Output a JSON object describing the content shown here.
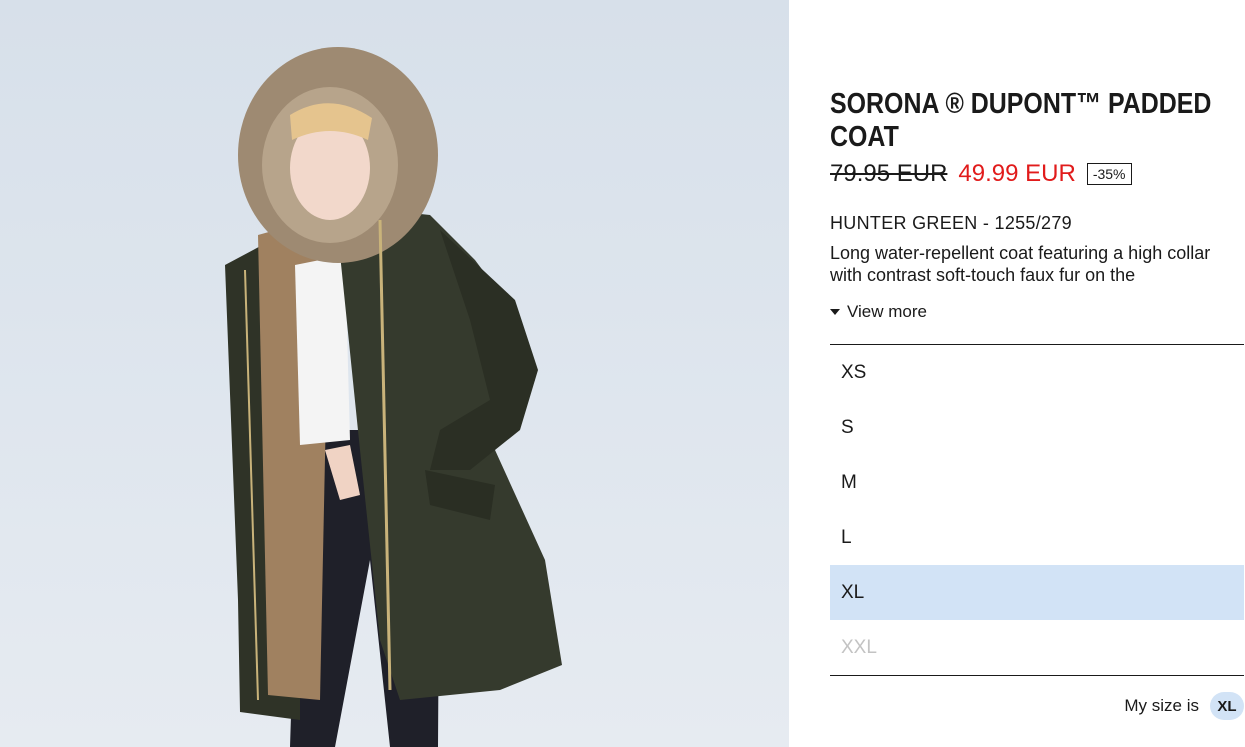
{
  "product": {
    "title": "SORONA ® DUPONT™ PADDED COAT",
    "old_price": "79.95 EUR",
    "new_price": "49.99 EUR",
    "discount": "-35%",
    "color_ref": "HUNTER GREEN - 1255/279",
    "description": "Long water-repellent coat featuring a high collar with contrast soft-touch faux fur on the",
    "view_more": "View more"
  },
  "sizes": [
    {
      "label": "XS",
      "state": "available"
    },
    {
      "label": "S",
      "state": "available"
    },
    {
      "label": "M",
      "state": "available"
    },
    {
      "label": "L",
      "state": "available"
    },
    {
      "label": "XL",
      "state": "selected"
    },
    {
      "label": "XXL",
      "state": "unavailable"
    }
  ],
  "my_size": {
    "label": "My size is",
    "value": "XL"
  },
  "colors": {
    "sale_price": "#e11b1b",
    "selected_size_bg": "#d2e3f6",
    "coat": "#2f3327"
  }
}
